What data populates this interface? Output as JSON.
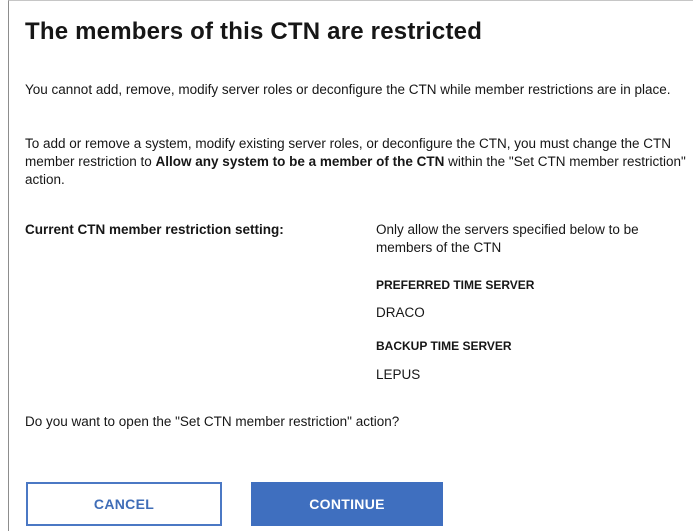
{
  "dialog": {
    "title": "The members of this CTN are restricted",
    "paragraph1": "You cannot add, remove, modify server roles or deconfigure the CTN while member restrictions are in place.",
    "paragraph2_before": "To add or remove a system, modify existing server roles, or deconfigure the CTN, you must change the CTN member restriction to ",
    "paragraph2_bold": "Allow any system to be a member of the CTN",
    "paragraph2_after": " within the \"Set CTN member restriction\" action.",
    "setting": {
      "label": "Current CTN member restriction setting:",
      "value": "Only allow the servers specified below to be members of the CTN",
      "preferred_heading": "PREFERRED TIME SERVER",
      "preferred_value": "DRACO",
      "backup_heading": "BACKUP TIME SERVER",
      "backup_value": "LEPUS"
    },
    "question": "Do you want to open the \"Set CTN member restriction\" action?",
    "buttons": {
      "cancel": "CANCEL",
      "continue": "CONTINUE"
    }
  },
  "colors": {
    "primary": "#3f6fbf",
    "text": "#161616",
    "border": "#8d8d8d"
  }
}
